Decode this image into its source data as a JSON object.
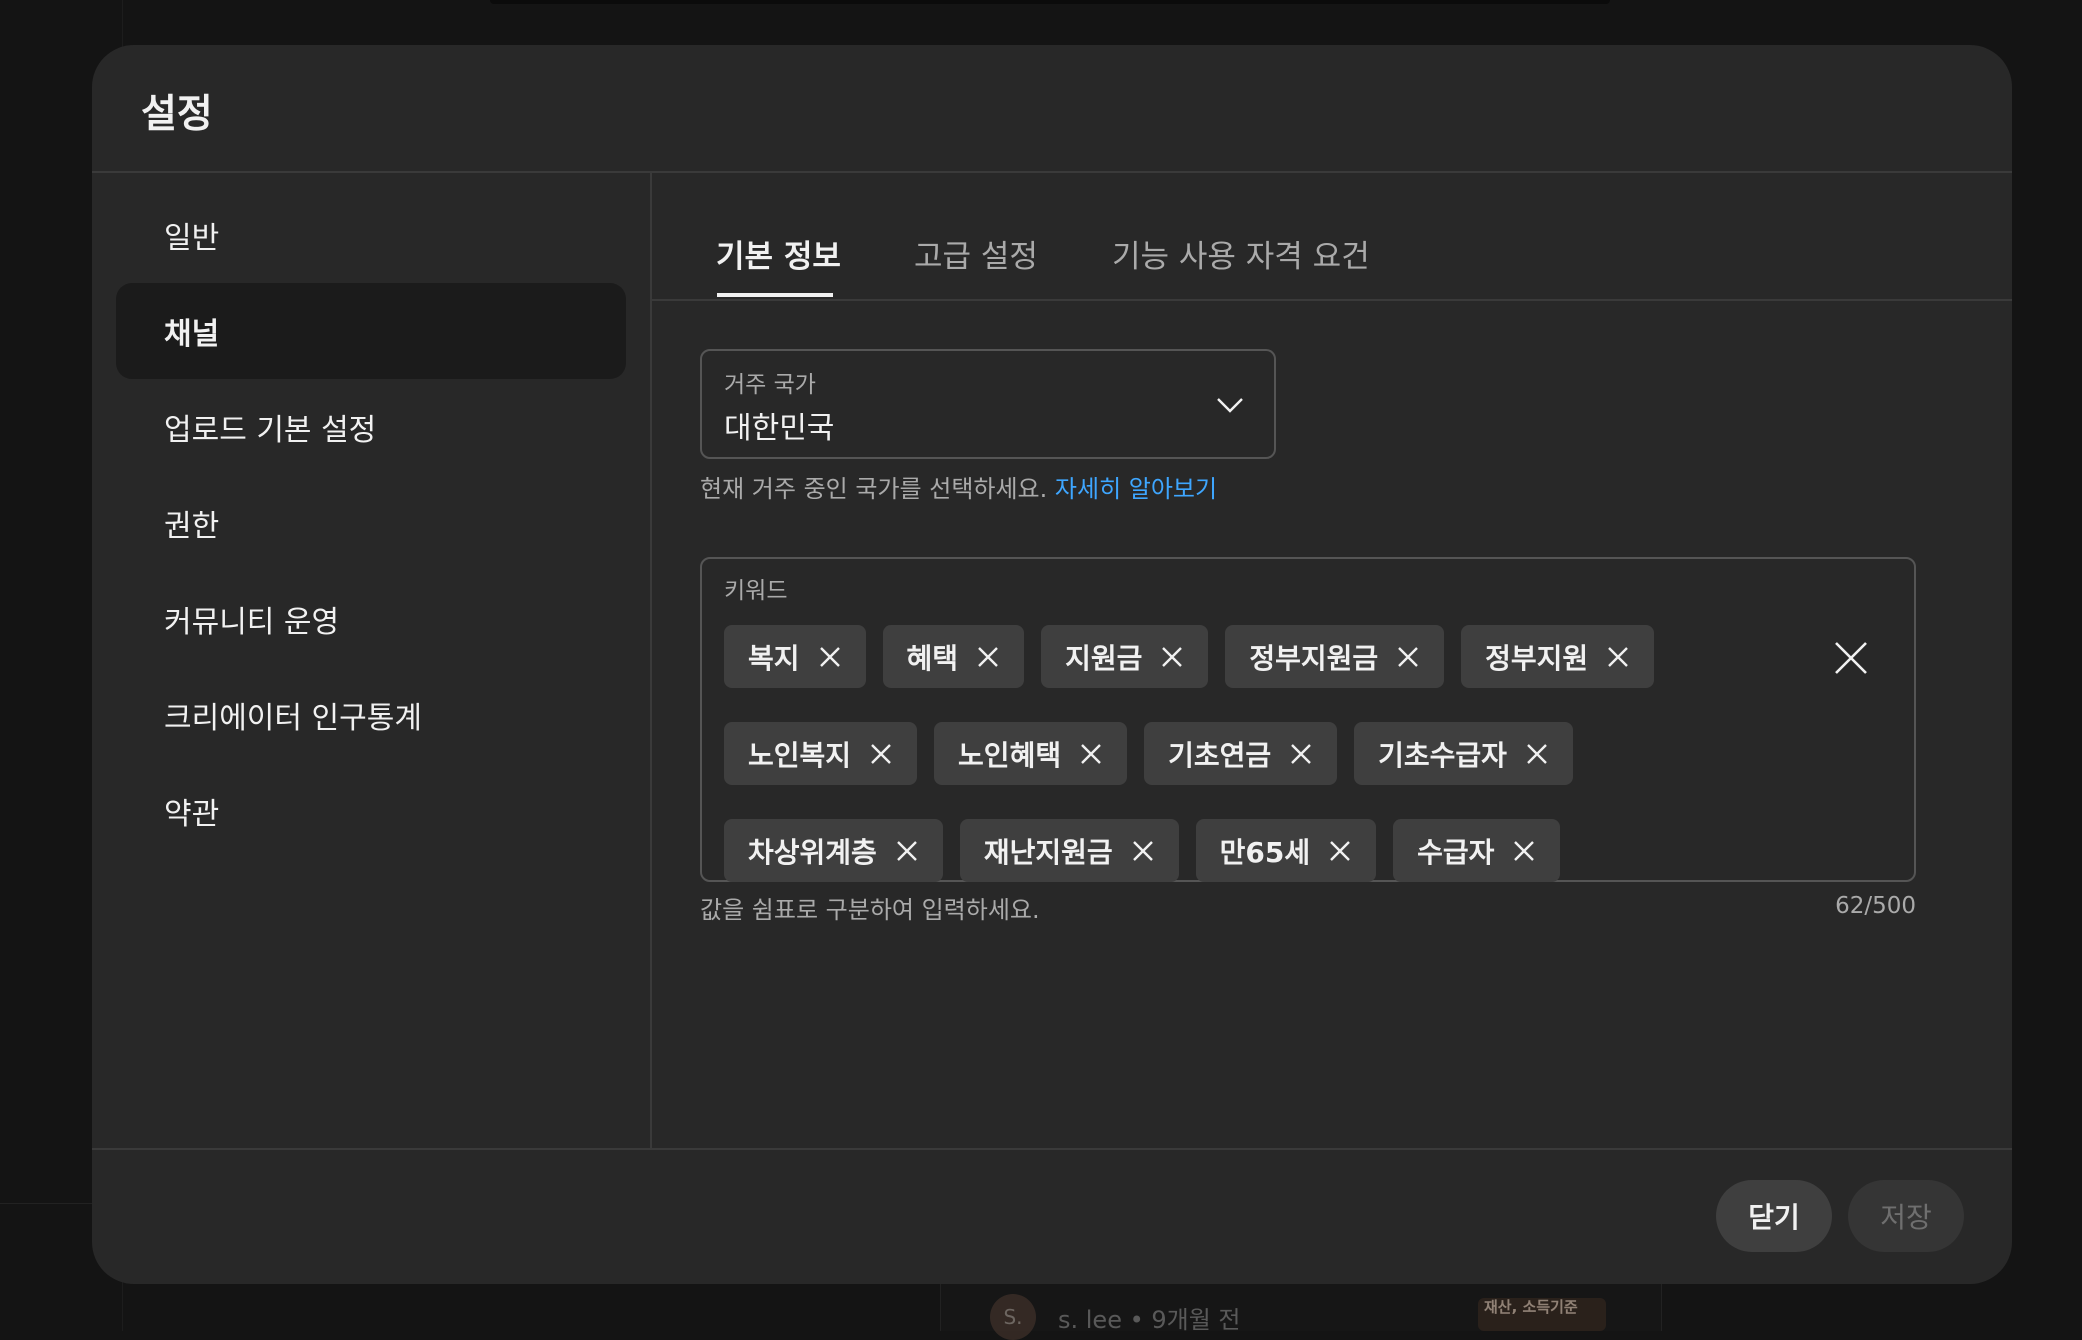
{
  "dialog": {
    "title": "설정"
  },
  "sidebar": {
    "items": [
      {
        "label": "일반",
        "active": false
      },
      {
        "label": "채널",
        "active": true
      },
      {
        "label": "업로드 기본 설정",
        "active": false
      },
      {
        "label": "권한",
        "active": false
      },
      {
        "label": "커뮤니티 운영",
        "active": false
      },
      {
        "label": "크리에이터 인구통계",
        "active": false
      },
      {
        "label": "약관",
        "active": false
      }
    ]
  },
  "tabs": [
    {
      "label": "기본 정보",
      "active": true
    },
    {
      "label": "고급 설정",
      "active": false
    },
    {
      "label": "기능 사용 자격 요건",
      "active": false
    }
  ],
  "country": {
    "label": "거주 국가",
    "value": "대한민국",
    "help_text": "현재 거주 중인 국가를 선택하세요.",
    "help_link": "자세히 알아보기"
  },
  "keywords": {
    "label": "키워드",
    "chips": [
      "복지",
      "혜택",
      "지원금",
      "정부지원금",
      "정부지원",
      "노인복지",
      "노인혜택",
      "기초연금",
      "기초수급자",
      "차상위계층",
      "재난지원금",
      "만65세",
      "수급자"
    ],
    "help_text": "값을 쉼표로 구분하여 입력하세요.",
    "counter": "62/500"
  },
  "footer": {
    "close_label": "닫기",
    "save_label": "저장"
  },
  "background": {
    "avatar_letter": "S.",
    "comment_meta": "s. lee • 9개월 전",
    "thumb_text": "재산, 소득기준"
  },
  "colors": {
    "accent_link": "#3ea6ff",
    "dialog_bg": "#282828",
    "chip_bg": "#3f3f3f",
    "page_bg": "#141414"
  }
}
